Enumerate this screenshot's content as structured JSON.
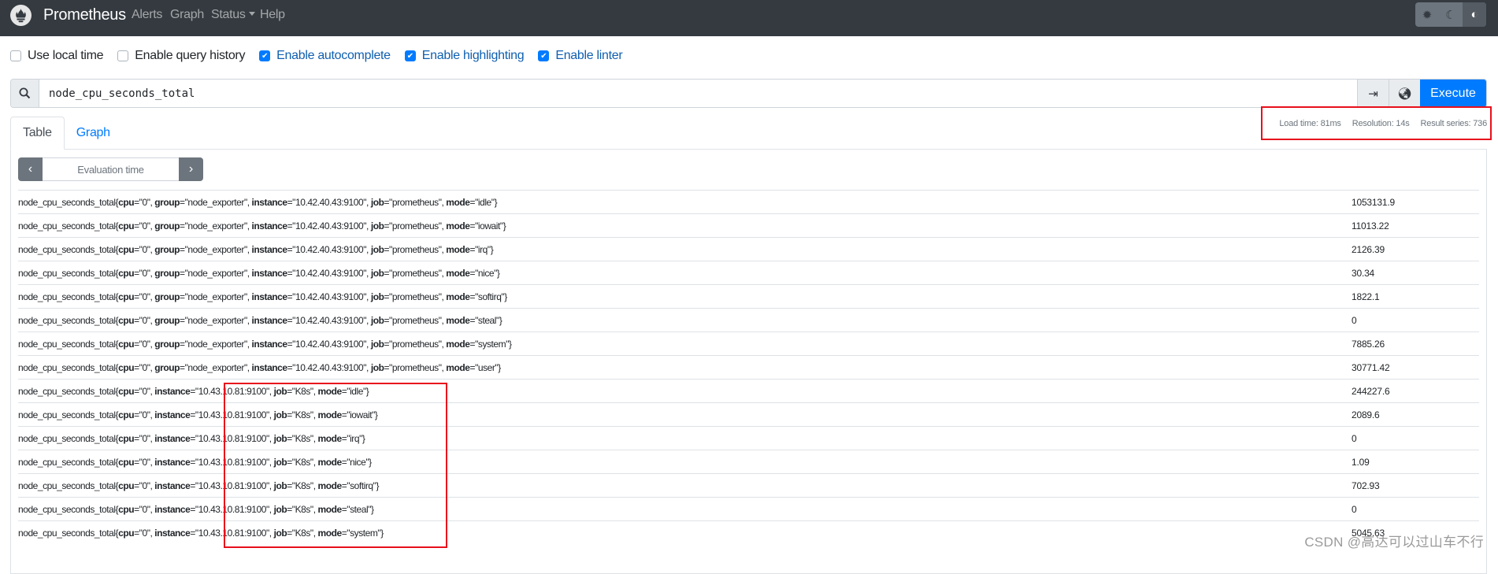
{
  "navbar": {
    "brand": "Prometheus",
    "links": [
      "Alerts",
      "Graph",
      "Status",
      "Help"
    ],
    "theme_icons": [
      "sun-icon",
      "moon-icon",
      "contrast-icon"
    ],
    "active_theme": "contrast"
  },
  "options": [
    {
      "label": "Use local time",
      "checked": false
    },
    {
      "label": "Enable query history",
      "checked": false
    },
    {
      "label": "Enable autocomplete",
      "checked": true
    },
    {
      "label": "Enable highlighting",
      "checked": true
    },
    {
      "label": "Enable linter",
      "checked": true
    }
  ],
  "query": {
    "value": "node_cpu_seconds_total",
    "execute_label": "Execute"
  },
  "stats": {
    "load_time": "Load time: 81ms",
    "resolution": "Resolution: 14s",
    "result_series": "Result series: 736"
  },
  "tabs": [
    {
      "label": "Table",
      "active": true
    },
    {
      "label": "Graph",
      "active": false
    }
  ],
  "evaluation_time_placeholder": "Evaluation time",
  "metric": "node_cpu_seconds_total",
  "rows": [
    {
      "labels": [
        [
          "cpu",
          "0"
        ],
        [
          "group",
          "node_exporter"
        ],
        [
          "instance",
          "10.42.40.43:9100"
        ],
        [
          "job",
          "prometheus"
        ],
        [
          "mode",
          "idle"
        ]
      ],
      "value": "1053131.9"
    },
    {
      "labels": [
        [
          "cpu",
          "0"
        ],
        [
          "group",
          "node_exporter"
        ],
        [
          "instance",
          "10.42.40.43:9100"
        ],
        [
          "job",
          "prometheus"
        ],
        [
          "mode",
          "iowait"
        ]
      ],
      "value": "11013.22"
    },
    {
      "labels": [
        [
          "cpu",
          "0"
        ],
        [
          "group",
          "node_exporter"
        ],
        [
          "instance",
          "10.42.40.43:9100"
        ],
        [
          "job",
          "prometheus"
        ],
        [
          "mode",
          "irq"
        ]
      ],
      "value": "2126.39"
    },
    {
      "labels": [
        [
          "cpu",
          "0"
        ],
        [
          "group",
          "node_exporter"
        ],
        [
          "instance",
          "10.42.40.43:9100"
        ],
        [
          "job",
          "prometheus"
        ],
        [
          "mode",
          "nice"
        ]
      ],
      "value": "30.34"
    },
    {
      "labels": [
        [
          "cpu",
          "0"
        ],
        [
          "group",
          "node_exporter"
        ],
        [
          "instance",
          "10.42.40.43:9100"
        ],
        [
          "job",
          "prometheus"
        ],
        [
          "mode",
          "softirq"
        ]
      ],
      "value": "1822.1"
    },
    {
      "labels": [
        [
          "cpu",
          "0"
        ],
        [
          "group",
          "node_exporter"
        ],
        [
          "instance",
          "10.42.40.43:9100"
        ],
        [
          "job",
          "prometheus"
        ],
        [
          "mode",
          "steal"
        ]
      ],
      "value": "0"
    },
    {
      "labels": [
        [
          "cpu",
          "0"
        ],
        [
          "group",
          "node_exporter"
        ],
        [
          "instance",
          "10.42.40.43:9100"
        ],
        [
          "job",
          "prometheus"
        ],
        [
          "mode",
          "system"
        ]
      ],
      "value": "7885.26"
    },
    {
      "labels": [
        [
          "cpu",
          "0"
        ],
        [
          "group",
          "node_exporter"
        ],
        [
          "instance",
          "10.42.40.43:9100"
        ],
        [
          "job",
          "prometheus"
        ],
        [
          "mode",
          "user"
        ]
      ],
      "value": "30771.42"
    },
    {
      "labels": [
        [
          "cpu",
          "0"
        ],
        [
          "instance",
          "10.43.10.81:9100"
        ],
        [
          "job",
          "K8s"
        ],
        [
          "mode",
          "idle"
        ]
      ],
      "value": "244227.6"
    },
    {
      "labels": [
        [
          "cpu",
          "0"
        ],
        [
          "instance",
          "10.43.10.81:9100"
        ],
        [
          "job",
          "K8s"
        ],
        [
          "mode",
          "iowait"
        ]
      ],
      "value": "2089.6"
    },
    {
      "labels": [
        [
          "cpu",
          "0"
        ],
        [
          "instance",
          "10.43.10.81:9100"
        ],
        [
          "job",
          "K8s"
        ],
        [
          "mode",
          "irq"
        ]
      ],
      "value": "0"
    },
    {
      "labels": [
        [
          "cpu",
          "0"
        ],
        [
          "instance",
          "10.43.10.81:9100"
        ],
        [
          "job",
          "K8s"
        ],
        [
          "mode",
          "nice"
        ]
      ],
      "value": "1.09"
    },
    {
      "labels": [
        [
          "cpu",
          "0"
        ],
        [
          "instance",
          "10.43.10.81:9100"
        ],
        [
          "job",
          "K8s"
        ],
        [
          "mode",
          "softirq"
        ]
      ],
      "value": "702.93"
    },
    {
      "labels": [
        [
          "cpu",
          "0"
        ],
        [
          "instance",
          "10.43.10.81:9100"
        ],
        [
          "job",
          "K8s"
        ],
        [
          "mode",
          "steal"
        ]
      ],
      "value": "0"
    },
    {
      "labels": [
        [
          "cpu",
          "0"
        ],
        [
          "instance",
          "10.43.10.81:9100"
        ],
        [
          "job",
          "K8s"
        ],
        [
          "mode",
          "system"
        ]
      ],
      "value": "5045.63"
    }
  ],
  "watermark": "CSDN @高达可以过山车不行",
  "colors": {
    "navbar": "#343a40",
    "accent": "#007bff",
    "annotation": "#e8101c"
  }
}
